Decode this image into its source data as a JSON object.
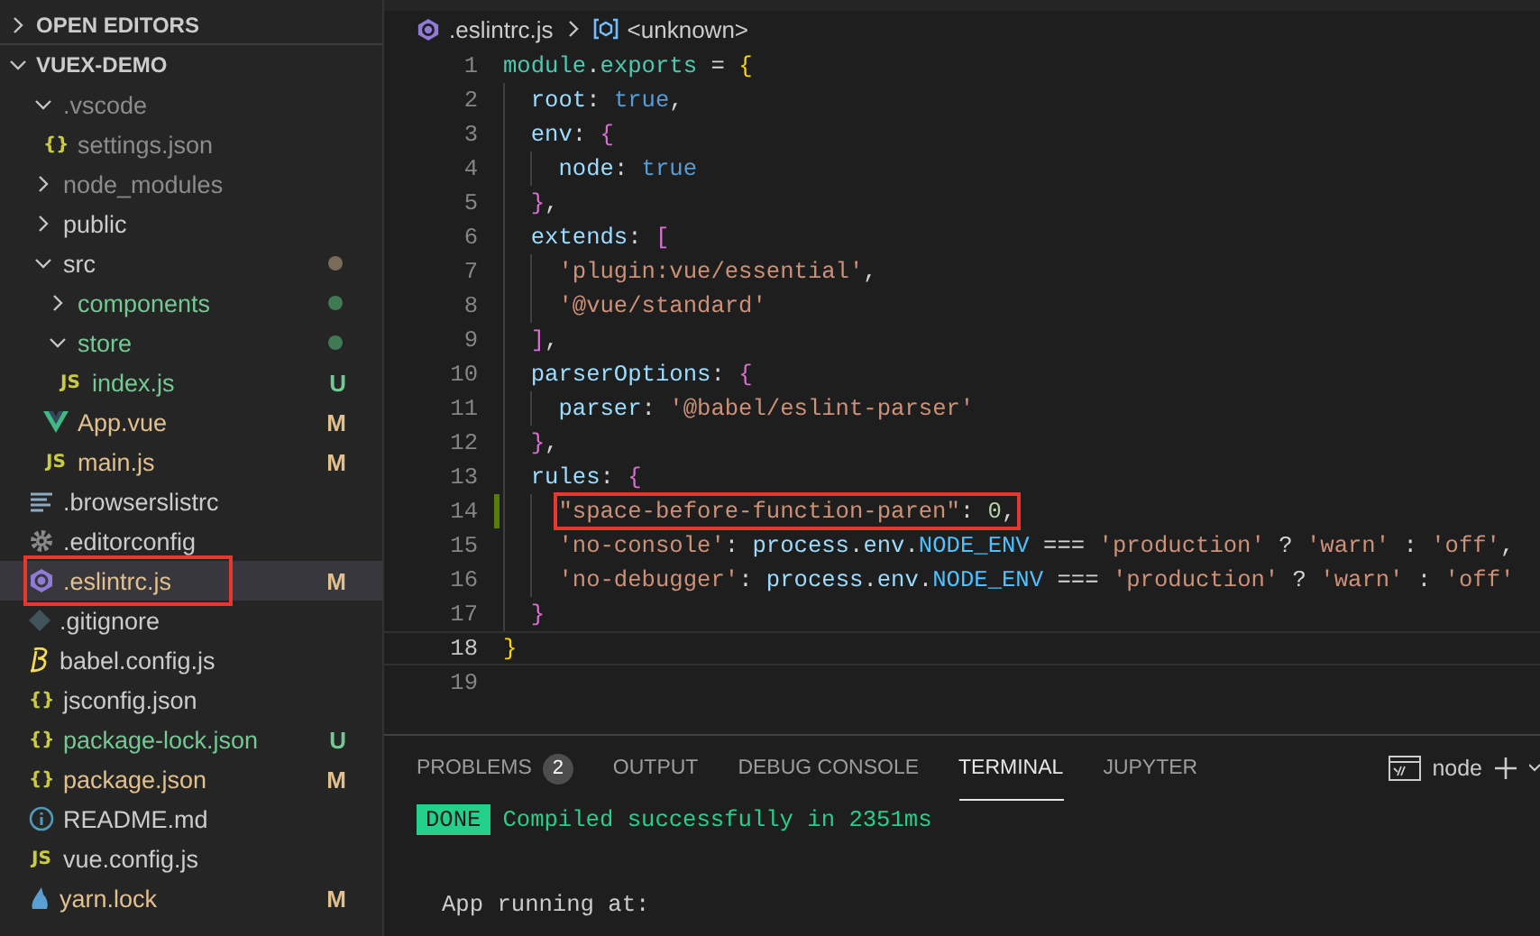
{
  "sidebar": {
    "sections": [
      {
        "title": "OPEN EDITORS",
        "expanded": false
      },
      {
        "title": "VUEX-DEMO",
        "expanded": true,
        "items": [
          {
            "kind": "folder",
            "name": ".vscode",
            "expanded": true,
            "color": "#8c8c8c",
            "children": [
              {
                "kind": "json",
                "icon_label": "{}",
                "name": "settings.json",
                "color": "#8c8c8c"
              }
            ]
          },
          {
            "kind": "folder",
            "name": "node_modules",
            "expanded": false,
            "color": "#8c8c8c"
          },
          {
            "kind": "folder",
            "name": "public",
            "expanded": false,
            "color": "#cccccc"
          },
          {
            "kind": "folder",
            "name": "src",
            "expanded": true,
            "color": "#cccccc",
            "dot": {
              "color": "#7a6c58"
            },
            "children": [
              {
                "kind": "folder",
                "name": "components",
                "expanded": false,
                "color": "#73c991",
                "dot": {
                  "color": "#3f7a55"
                }
              },
              {
                "kind": "folder",
                "name": "store",
                "expanded": true,
                "color": "#73c991",
                "dot": {
                  "color": "#3f7a55"
                },
                "children": [
                  {
                    "kind": "js",
                    "icon_label": "JS",
                    "name": "index.js",
                    "color": "#73c991",
                    "badge": "U"
                  }
                ]
              },
              {
                "kind": "vue",
                "name": "App.vue",
                "color": "#e2c08d",
                "badge": "M"
              },
              {
                "kind": "js",
                "icon_label": "JS",
                "name": "main.js",
                "color": "#e2c08d",
                "badge": "M"
              }
            ]
          },
          {
            "kind": "lines",
            "name": ".browserslistrc",
            "color": "#cccccc"
          },
          {
            "kind": "gear",
            "name": ".editorconfig",
            "color": "#cccccc"
          },
          {
            "kind": "eslint",
            "name": ".eslintrc.js",
            "color": "#e2c08d",
            "badge": "M",
            "selected": true,
            "annotated": true
          },
          {
            "kind": "git",
            "name": ".gitignore",
            "color": "#cccccc"
          },
          {
            "kind": "babel",
            "name": "babel.config.js",
            "color": "#cccccc"
          },
          {
            "kind": "json",
            "icon_label": "{}",
            "name": "jsconfig.json",
            "color": "#cccccc"
          },
          {
            "kind": "json",
            "icon_label": "{}",
            "name": "package-lock.json",
            "color": "#73c991",
            "badge": "U"
          },
          {
            "kind": "json",
            "icon_label": "{}",
            "name": "package.json",
            "color": "#e2c08d",
            "badge": "M"
          },
          {
            "kind": "info",
            "name": "README.md",
            "color": "#cccccc"
          },
          {
            "kind": "js",
            "icon_label": "JS",
            "name": "vue.config.js",
            "color": "#cccccc"
          },
          {
            "kind": "yarn",
            "name": "yarn.lock",
            "color": "#e2c08d",
            "badge": "M"
          }
        ]
      }
    ]
  },
  "breadcrumb": [
    {
      "kind": "file",
      "text": ".eslintrc.js"
    },
    {
      "kind": "symbol",
      "text": "<unknown>"
    }
  ],
  "editor": {
    "lines": [
      {
        "number": "1",
        "tokens": [
          {
            "kind": "module",
            "text": "module"
          },
          {
            "kind": "punct",
            "text": "."
          },
          {
            "kind": "module",
            "text": "exports"
          },
          {
            "kind": "punct",
            "text": " = "
          },
          {
            "kind": "bracket1",
            "text": "{"
          }
        ],
        "children": [
          {
            "number": "2",
            "tokens": [
              {
                "kind": "prop",
                "text": "root"
              },
              {
                "kind": "punct",
                "text": ": "
              },
              {
                "kind": "bool",
                "text": "true"
              },
              {
                "kind": "punct",
                "text": ","
              }
            ]
          },
          {
            "number": "3",
            "tokens": [
              {
                "kind": "prop",
                "text": "env"
              },
              {
                "kind": "punct",
                "text": ": "
              },
              {
                "kind": "bracket2",
                "text": "{"
              }
            ],
            "children": [
              {
                "number": "4",
                "tokens": [
                  {
                    "kind": "prop",
                    "text": "node"
                  },
                  {
                    "kind": "punct",
                    "text": ": "
                  },
                  {
                    "kind": "bool",
                    "text": "true"
                  }
                ]
              }
            ]
          },
          {
            "number": "5",
            "tokens": [
              {
                "kind": "bracket2",
                "text": "}"
              },
              {
                "kind": "punct",
                "text": ","
              }
            ]
          },
          {
            "number": "6",
            "tokens": [
              {
                "kind": "prop",
                "text": "extends"
              },
              {
                "kind": "punct",
                "text": ": "
              },
              {
                "kind": "bracket2",
                "text": "["
              }
            ],
            "children": [
              {
                "number": "7",
                "tokens": [
                  {
                    "kind": "string",
                    "text": "'plugin:vue/essential'"
                  },
                  {
                    "kind": "punct",
                    "text": ","
                  }
                ]
              },
              {
                "number": "8",
                "tokens": [
                  {
                    "kind": "string",
                    "text": "'@vue/standard'"
                  }
                ]
              }
            ]
          },
          {
            "number": "9",
            "tokens": [
              {
                "kind": "bracket2",
                "text": "]"
              },
              {
                "kind": "punct",
                "text": ","
              }
            ]
          },
          {
            "number": "10",
            "tokens": [
              {
                "kind": "prop",
                "text": "parserOptions"
              },
              {
                "kind": "punct",
                "text": ": "
              },
              {
                "kind": "bracket2",
                "text": "{"
              }
            ],
            "children": [
              {
                "number": "11",
                "tokens": [
                  {
                    "kind": "prop",
                    "text": "parser"
                  },
                  {
                    "kind": "punct",
                    "text": ": "
                  },
                  {
                    "kind": "string",
                    "text": "'@babel/eslint-parser'"
                  }
                ]
              }
            ]
          },
          {
            "number": "12",
            "tokens": [
              {
                "kind": "bracket2",
                "text": "}"
              },
              {
                "kind": "punct",
                "text": ","
              }
            ]
          },
          {
            "number": "13",
            "tokens": [
              {
                "kind": "prop",
                "text": "rules"
              },
              {
                "kind": "punct",
                "text": ": "
              },
              {
                "kind": "bracket2",
                "text": "{"
              }
            ],
            "children": [
              {
                "number": "14",
                "changed": true,
                "annotated": true,
                "tokens": [
                  {
                    "kind": "string",
                    "text": "\"space-before-function-paren\""
                  },
                  {
                    "kind": "punct",
                    "text": ": "
                  },
                  {
                    "kind": "number",
                    "text": "0"
                  },
                  {
                    "kind": "punct",
                    "text": ","
                  }
                ]
              },
              {
                "number": "15",
                "tokens": [
                  {
                    "kind": "string",
                    "text": "'no-console'"
                  },
                  {
                    "kind": "punct",
                    "text": ": "
                  },
                  {
                    "kind": "prop",
                    "text": "process"
                  },
                  {
                    "kind": "punct",
                    "text": "."
                  },
                  {
                    "kind": "prop",
                    "text": "env"
                  },
                  {
                    "kind": "punct",
                    "text": "."
                  },
                  {
                    "kind": "const",
                    "text": "NODE_ENV"
                  },
                  {
                    "kind": "punct",
                    "text": " === "
                  },
                  {
                    "kind": "string",
                    "text": "'production'"
                  },
                  {
                    "kind": "punct",
                    "text": " ? "
                  },
                  {
                    "kind": "string",
                    "text": "'warn'"
                  },
                  {
                    "kind": "punct",
                    "text": " : "
                  },
                  {
                    "kind": "string",
                    "text": "'off'"
                  },
                  {
                    "kind": "punct",
                    "text": ","
                  }
                ]
              },
              {
                "number": "16",
                "tokens": [
                  {
                    "kind": "string",
                    "text": "'no-debugger'"
                  },
                  {
                    "kind": "punct",
                    "text": ": "
                  },
                  {
                    "kind": "prop",
                    "text": "process"
                  },
                  {
                    "kind": "punct",
                    "text": "."
                  },
                  {
                    "kind": "prop",
                    "text": "env"
                  },
                  {
                    "kind": "punct",
                    "text": "."
                  },
                  {
                    "kind": "const",
                    "text": "NODE_ENV"
                  },
                  {
                    "kind": "punct",
                    "text": " === "
                  },
                  {
                    "kind": "string",
                    "text": "'production'"
                  },
                  {
                    "kind": "punct",
                    "text": " ? "
                  },
                  {
                    "kind": "string",
                    "text": "'warn'"
                  },
                  {
                    "kind": "punct",
                    "text": " : "
                  },
                  {
                    "kind": "string",
                    "text": "'off'"
                  }
                ]
              }
            ]
          },
          {
            "number": "17",
            "tokens": [
              {
                "kind": "bracket2",
                "text": "}"
              }
            ]
          }
        ]
      },
      {
        "number": "18",
        "current": true,
        "tokens": [
          {
            "kind": "bracket1",
            "text": "}"
          }
        ]
      },
      {
        "number": "19"
      }
    ]
  },
  "panel": {
    "tabs": [
      {
        "label": "PROBLEMS",
        "count": "2",
        "selected": false
      },
      {
        "label": "OUTPUT",
        "selected": false
      },
      {
        "label": "DEBUG CONSOLE",
        "selected": false
      },
      {
        "label": "TERMINAL",
        "selected": true
      },
      {
        "label": "JUPYTER",
        "selected": false
      }
    ],
    "terminal_name": "node",
    "terminal": {
      "status": "DONE",
      "message": "Compiled successfully in 2351ms",
      "lines": [
        "App running at:"
      ]
    }
  }
}
